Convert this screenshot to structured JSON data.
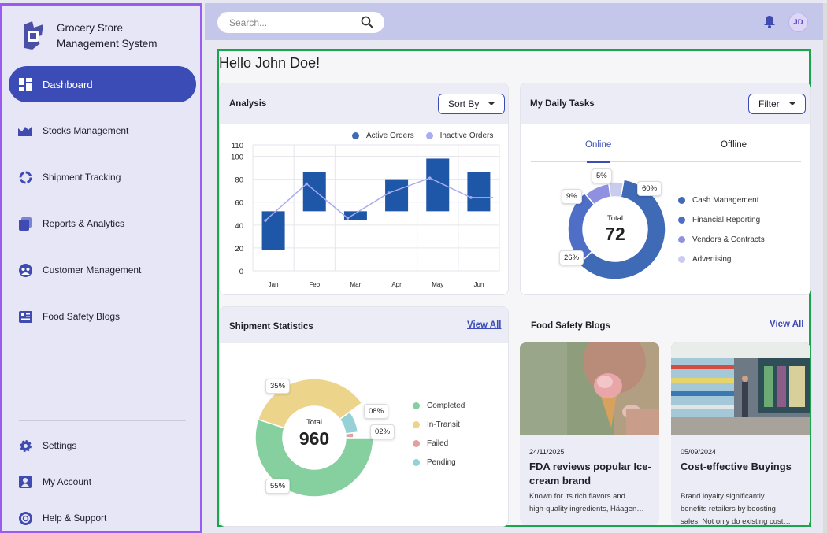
{
  "brand": {
    "name": "Grocery Store Management System",
    "logo": "grocery-logo-icon"
  },
  "sidebar": {
    "items": [
      {
        "label": "Dashboard",
        "icon": "dashboard-icon",
        "active": true
      },
      {
        "label": "Stocks Management",
        "icon": "stocks-icon"
      },
      {
        "label": "Shipment Tracking",
        "icon": "shipment-icon"
      },
      {
        "label": "Reports & Analytics",
        "icon": "reports-icon"
      },
      {
        "label": "Customer Management",
        "icon": "customer-icon"
      },
      {
        "label": "Food Safety Blogs",
        "icon": "blog-icon"
      }
    ],
    "bottom": [
      {
        "label": "Settings",
        "icon": "gear-icon"
      },
      {
        "label": "My Account",
        "icon": "account-icon"
      },
      {
        "label": "Help & Support",
        "icon": "help-icon"
      }
    ]
  },
  "topbar": {
    "search_placeholder": "Search...",
    "avatar_initials": "JD"
  },
  "greeting": "Hello John Doe!",
  "analysis": {
    "title": "Analysis",
    "sort_label": "Sort By",
    "legend": [
      {
        "label": "Active Orders",
        "color": "#1e56a8"
      },
      {
        "label": "Inactive Orders",
        "color": "#a8acf0"
      }
    ]
  },
  "tasks": {
    "title": "My Daily Tasks",
    "filter_label": "Filter",
    "tabs": [
      "Online",
      "Offline"
    ],
    "total_label": "Total",
    "total": "72",
    "legend": [
      {
        "label": "Cash Management",
        "color": "#3f6ab5"
      },
      {
        "label": "Financial Reporting",
        "color": "#4f6fc7"
      },
      {
        "label": "Vendors & Contracts",
        "color": "#8f91e0"
      },
      {
        "label": "Advertising",
        "color": "#c9cbef"
      }
    ],
    "pcts": [
      "60%",
      "26%",
      "9%",
      "5%"
    ]
  },
  "shipment": {
    "title": "Shipment Statistics",
    "view_all": "View All",
    "total_label": "Total",
    "total": "960",
    "legend": [
      {
        "label": "Completed",
        "color": "#86d0a0"
      },
      {
        "label": "In-Transit",
        "color": "#ecd58b"
      },
      {
        "label": "Failed",
        "color": "#e0a1a1"
      },
      {
        "label": "Pending",
        "color": "#95d1d6"
      }
    ],
    "pcts": [
      "35%",
      "08%",
      "02%",
      "55%"
    ]
  },
  "blogs": {
    "title": "Food Safety Blogs",
    "view_all": "View All",
    "posts": [
      {
        "date": "24/11/2025",
        "title": "FDA reviews popular Ice-cream brand",
        "desc1": "Known for its rich flavors and",
        "desc2": "high-quality ingredients, Häagen…"
      },
      {
        "date": "05/09/2024",
        "title": "Cost-effective Buyings",
        "desc1": "Brand loyalty significantly",
        "desc2": "benefits retailers by boosting",
        "desc3": "sales. Not only do existing cust…"
      }
    ]
  },
  "chart_data": [
    {
      "type": "bar",
      "categories": [
        "Jan",
        "Feb",
        "Mar",
        "Apr",
        "May",
        "Jun"
      ],
      "series": [
        {
          "name": "Active Orders",
          "kind": "floating-bar",
          "low": [
            18,
            52,
            44,
            52,
            52,
            52
          ],
          "high": [
            52,
            86,
            52,
            80,
            98,
            86
          ]
        },
        {
          "name": "Inactive Orders",
          "kind": "line",
          "values": [
            44,
            76,
            46,
            68,
            81,
            64
          ]
        }
      ],
      "ylim": [
        0,
        110
      ],
      "yticks": [
        110,
        100,
        80,
        60,
        40,
        20,
        0
      ],
      "grid": true,
      "legend": "top-right"
    },
    {
      "type": "pie",
      "center_label": "Total",
      "center_value": 72,
      "slices": [
        {
          "label": "Cash Management",
          "value": 60
        },
        {
          "label": "Financial Reporting",
          "value": 26
        },
        {
          "label": "Vendors & Contracts",
          "value": 9
        },
        {
          "label": "Advertising",
          "value": 5
        }
      ]
    },
    {
      "type": "pie",
      "center_label": "Total",
      "center_value": 960,
      "slices": [
        {
          "label": "Completed",
          "value": 55
        },
        {
          "label": "In-Transit",
          "value": 35
        },
        {
          "label": "Failed",
          "value": 2
        },
        {
          "label": "Pending",
          "value": 8
        }
      ]
    }
  ]
}
